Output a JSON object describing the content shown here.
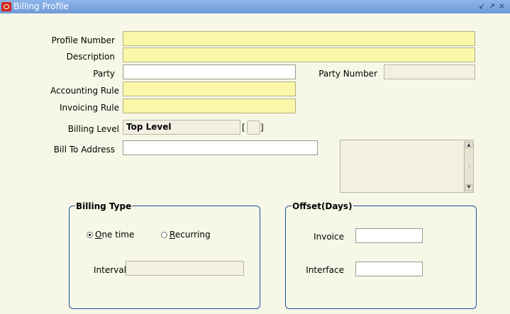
{
  "window": {
    "title": "Billing Profile",
    "min_icon": "↙",
    "max_icon": "↗",
    "close_icon": "×"
  },
  "form": {
    "profile_number": {
      "label": "Profile Number",
      "value": ""
    },
    "description": {
      "label": "Description",
      "value": ""
    },
    "party": {
      "label": "Party",
      "value": ""
    },
    "party_number": {
      "label": "Party Number",
      "value": ""
    },
    "accounting_rule": {
      "label": "Accounting Rule",
      "value": ""
    },
    "invoicing_rule": {
      "label": "Invoicing Rule",
      "value": ""
    },
    "billing_level": {
      "label": "Billing Level",
      "value": "Top Level",
      "bracket_left": "[",
      "bracket_right": "]"
    },
    "bill_to_address": {
      "label": "Bill To Address",
      "value": ""
    }
  },
  "billing_type": {
    "legend": "Billing Type",
    "one_time": {
      "mnemonic": "O",
      "rest": "ne time",
      "selected": true
    },
    "recurring": {
      "mnemonic": "R",
      "rest": "ecurring",
      "selected": false
    },
    "interval": {
      "label": "Interval",
      "value": ""
    }
  },
  "offset": {
    "legend": "Offset(Days)",
    "invoice": {
      "label": "Invoice",
      "value": ""
    },
    "interface": {
      "label": "Interface",
      "value": ""
    }
  },
  "icons": {
    "scroll_up": "chevron-up-icon",
    "scroll_down": "chevron-down-icon"
  }
}
